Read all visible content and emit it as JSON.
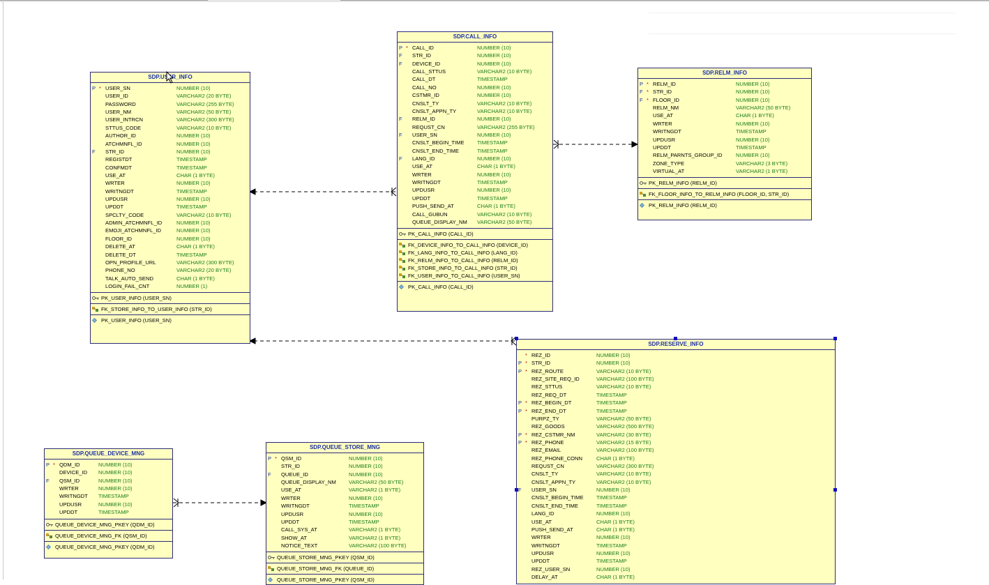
{
  "tables": {
    "user_info": {
      "title": "SDP.USER_INFO",
      "columns": [
        {
          "k": "P",
          "m": "*",
          "n": "USER_SN",
          "t": "NUMBER (10)"
        },
        {
          "k": "",
          "m": "",
          "n": "USER_ID",
          "t": "VARCHAR2 (20 BYTE)"
        },
        {
          "k": "",
          "m": "",
          "n": "PASSWORD",
          "t": "VARCHAR2 (255 BYTE)"
        },
        {
          "k": "",
          "m": "",
          "n": "USER_NM",
          "t": "VARCHAR2 (50 BYTE)"
        },
        {
          "k": "",
          "m": "",
          "n": "USER_INTRCN",
          "t": "VARCHAR2 (300 BYTE)"
        },
        {
          "k": "",
          "m": "",
          "n": "STTUS_CODE",
          "t": "VARCHAR2 (10 BYTE)"
        },
        {
          "k": "",
          "m": "",
          "n": "AUTHOR_ID",
          "t": "NUMBER (10)"
        },
        {
          "k": "",
          "m": "",
          "n": "ATCHMNFL_ID",
          "t": "NUMBER (10)"
        },
        {
          "k": "F",
          "m": "",
          "n": "STR_ID",
          "t": "NUMBER (10)"
        },
        {
          "k": "",
          "m": "",
          "n": "REGISTDT",
          "t": "TIMESTAMP"
        },
        {
          "k": "",
          "m": "",
          "n": "CONFMDT",
          "t": "TIMESTAMP"
        },
        {
          "k": "",
          "m": "",
          "n": "USE_AT",
          "t": "CHAR (1 BYTE)"
        },
        {
          "k": "",
          "m": "",
          "n": "WRTER",
          "t": "NUMBER (10)"
        },
        {
          "k": "",
          "m": "",
          "n": "WRITNGDT",
          "t": "TIMESTAMP"
        },
        {
          "k": "",
          "m": "",
          "n": "UPDUSR",
          "t": "NUMBER (10)"
        },
        {
          "k": "",
          "m": "",
          "n": "UPDDT",
          "t": "TIMESTAMP"
        },
        {
          "k": "",
          "m": "",
          "n": "SPCLTY_CODE",
          "t": "VARCHAR2 (10 BYTE)"
        },
        {
          "k": "",
          "m": "",
          "n": "ADMIN_ATCHMNFL_ID",
          "t": "NUMBER (10)"
        },
        {
          "k": "",
          "m": "",
          "n": "EMOJI_ATCHMNFL_ID",
          "t": "NUMBER (10)"
        },
        {
          "k": "",
          "m": "",
          "n": "FLOOR_ID",
          "t": "NUMBER (10)"
        },
        {
          "k": "",
          "m": "",
          "n": "DELETE_AT",
          "t": "CHAR (1 BYTE)"
        },
        {
          "k": "",
          "m": "",
          "n": "DELETE_DT",
          "t": "TIMESTAMP"
        },
        {
          "k": "",
          "m": "",
          "n": "OPN_PROFILE_URL",
          "t": "VARCHAR2 (300 BYTE)"
        },
        {
          "k": "",
          "m": "",
          "n": "PHONE_NO",
          "t": "VARCHAR2 (20 BYTE)"
        },
        {
          "k": "",
          "m": "",
          "n": "TALK_AUTO_SEND",
          "t": "CHAR (1 BYTE)"
        },
        {
          "k": "",
          "m": "",
          "n": "LOGIN_FAIL_CNT",
          "t": "NUMBER (1)"
        }
      ],
      "pk": [
        "PK_USER_INFO (USER_SN)"
      ],
      "fk": [
        "FK_STORE_INFO_TO_USER_INFO (STR_ID)"
      ],
      "idx": [
        "PK_USER_INFO (USER_SN)"
      ]
    },
    "call_info": {
      "title": "SDP.CALL_INFO",
      "columns": [
        {
          "k": "P",
          "m": "*",
          "n": "CALL_ID",
          "t": "NUMBER (10)"
        },
        {
          "k": "F",
          "m": "",
          "n": "STR_ID",
          "t": "NUMBER (10)"
        },
        {
          "k": "F",
          "m": "",
          "n": "DEVICE_ID",
          "t": "NUMBER (10)"
        },
        {
          "k": "",
          "m": "",
          "n": "CALL_STTUS",
          "t": "VARCHAR2 (10 BYTE)"
        },
        {
          "k": "",
          "m": "",
          "n": "CALL_DT",
          "t": "TIMESTAMP"
        },
        {
          "k": "",
          "m": "",
          "n": "CALL_NO",
          "t": "NUMBER (10)"
        },
        {
          "k": "",
          "m": "",
          "n": "CSTMR_ID",
          "t": "NUMBER (10)"
        },
        {
          "k": "",
          "m": "",
          "n": "CNSLT_TY",
          "t": "VARCHAR2 (10 BYTE)"
        },
        {
          "k": "",
          "m": "",
          "n": "CNSLT_APPN_TY",
          "t": "VARCHAR2 (10 BYTE)"
        },
        {
          "k": "F",
          "m": "",
          "n": "RELM_ID",
          "t": "NUMBER (10)"
        },
        {
          "k": "",
          "m": "",
          "n": "REQUST_CN",
          "t": "VARCHAR2 (255 BYTE)"
        },
        {
          "k": "F",
          "m": "",
          "n": "USER_SN",
          "t": "NUMBER (10)"
        },
        {
          "k": "",
          "m": "",
          "n": "CNSLT_BEGIN_TIME",
          "t": "TIMESTAMP"
        },
        {
          "k": "",
          "m": "",
          "n": "CNSLT_END_TIME",
          "t": "TIMESTAMP"
        },
        {
          "k": "F",
          "m": "",
          "n": "LANG_ID",
          "t": "NUMBER (10)"
        },
        {
          "k": "",
          "m": "",
          "n": "USE_AT",
          "t": "CHAR (1 BYTE)"
        },
        {
          "k": "",
          "m": "",
          "n": "WRTER",
          "t": "NUMBER (10)"
        },
        {
          "k": "",
          "m": "",
          "n": "WRITNGDT",
          "t": "TIMESTAMP"
        },
        {
          "k": "",
          "m": "",
          "n": "UPDUSR",
          "t": "NUMBER (10)"
        },
        {
          "k": "",
          "m": "",
          "n": "UPDDT",
          "t": "TIMESTAMP"
        },
        {
          "k": "",
          "m": "",
          "n": "PUSH_SEND_AT",
          "t": "CHAR (1 BYTE)"
        },
        {
          "k": "",
          "m": "",
          "n": "CALL_GUBUN",
          "t": "VARCHAR2 (10 BYTE)"
        },
        {
          "k": "",
          "m": "",
          "n": "QUEUE_DISPLAY_NM",
          "t": "VARCHAR2 (50 BYTE)"
        }
      ],
      "pk": [
        "PK_CALL_INFO (CALL_ID)"
      ],
      "fk": [
        "FK_DEVICE_INFO_TO_CALL_INFO (DEVICE_ID)",
        "FK_LANG_INFO_TO_CALL_INFO (LANG_ID)",
        "FK_RELM_INFO_TO_CALL_INFO (RELM_ID)",
        "FK_STORE_INFO_TO_CALL_INFO (STR_ID)",
        "FK_USER_INFO_TO_CALL_INFO (USER_SN)"
      ],
      "idx": [
        "PK_CALL_INFO (CALL_ID)"
      ]
    },
    "relm_info": {
      "title": "SDP.RELM_INFO",
      "columns": [
        {
          "k": "P",
          "m": "*",
          "n": "RELM_ID",
          "t": "NUMBER (10)"
        },
        {
          "k": "F",
          "m": "*",
          "n": "STR_ID",
          "t": "NUMBER (10)"
        },
        {
          "k": "F",
          "m": "*",
          "n": "FLOOR_ID",
          "t": "NUMBER (10)"
        },
        {
          "k": "",
          "m": "",
          "n": "RELM_NM",
          "t": "VARCHAR2 (50 BYTE)"
        },
        {
          "k": "",
          "m": "",
          "n": "USE_AT",
          "t": "CHAR (1 BYTE)"
        },
        {
          "k": "",
          "m": "",
          "n": "WRTER",
          "t": "NUMBER (10)"
        },
        {
          "k": "",
          "m": "",
          "n": "WRITNGDT",
          "t": "TIMESTAMP"
        },
        {
          "k": "",
          "m": "",
          "n": "UPDUSR",
          "t": "NUMBER (10)"
        },
        {
          "k": "",
          "m": "",
          "n": "UPDDT",
          "t": "TIMESTAMP"
        },
        {
          "k": "",
          "m": "",
          "n": "RELM_PARNTS_GROUP_ID",
          "t": "NUMBER (10)"
        },
        {
          "k": "",
          "m": "",
          "n": "ZONE_TYPE",
          "t": "VARCHAR2 (3 BYTE)"
        },
        {
          "k": "",
          "m": "",
          "n": "VIRTUAL_AT",
          "t": "VARCHAR2 (1 BYTE)"
        }
      ],
      "pk": [
        "PK_RELM_INFO (RELM_ID)"
      ],
      "fk": [
        "FK_FLOOR_INFO_TO_RELM_INFO (FLOOR_ID, STR_ID)"
      ],
      "idx": [
        "PK_RELM_INFO (RELM_ID)"
      ]
    },
    "reserve_info": {
      "title": "SDP.RESERVE_INFO",
      "columns": [
        {
          "k": "",
          "m": "*",
          "n": "REZ_ID",
          "t": "NUMBER (10)"
        },
        {
          "k": "P",
          "m": "*",
          "n": "STR_ID",
          "t": "NUMBER (10)"
        },
        {
          "k": "P",
          "m": "*",
          "n": "REZ_ROUTE",
          "t": "VARCHAR2 (10 BYTE)"
        },
        {
          "k": "",
          "m": "",
          "n": "REZ_SITE_REQ_ID",
          "t": "VARCHAR2 (100 BYTE)"
        },
        {
          "k": "",
          "m": "",
          "n": "REZ_STTUS",
          "t": "VARCHAR2 (10 BYTE)"
        },
        {
          "k": "",
          "m": "",
          "n": "REZ_REQ_DT",
          "t": "TIMESTAMP"
        },
        {
          "k": "P",
          "m": "*",
          "n": "REZ_BEGIN_DT",
          "t": "TIMESTAMP"
        },
        {
          "k": "P",
          "m": "*",
          "n": "REZ_END_DT",
          "t": "TIMESTAMP"
        },
        {
          "k": "",
          "m": "",
          "n": "PURPZ_TY",
          "t": "VARCHAR2 (50 BYTE)"
        },
        {
          "k": "",
          "m": "",
          "n": "REZ_GOODS",
          "t": "VARCHAR2 (500 BYTE)"
        },
        {
          "k": "P",
          "m": "*",
          "n": "REZ_CSTMR_NM",
          "t": "VARCHAR2 (30 BYTE)"
        },
        {
          "k": "P",
          "m": "*",
          "n": "REZ_PHONE",
          "t": "VARCHAR2 (15 BYTE)"
        },
        {
          "k": "",
          "m": "",
          "n": "REZ_EMAIL",
          "t": "VARCHAR2 (100 BYTE)"
        },
        {
          "k": "",
          "m": "",
          "n": "REZ_PHONE_CONN",
          "t": "CHAR (1 BYTE)"
        },
        {
          "k": "",
          "m": "",
          "n": "REQUST_CN",
          "t": "VARCHAR2 (300 BYTE)"
        },
        {
          "k": "",
          "m": "",
          "n": "CNSLT_TY",
          "t": "VARCHAR2 (10 BYTE)"
        },
        {
          "k": "",
          "m": "",
          "n": "CNSLT_APPN_TY",
          "t": "VARCHAR2 (10 BYTE)"
        },
        {
          "k": "F",
          "m": "",
          "n": "USER_SN",
          "t": "NUMBER (10)"
        },
        {
          "k": "",
          "m": "",
          "n": "CNSLT_BEGIN_TIME",
          "t": "TIMESTAMP"
        },
        {
          "k": "",
          "m": "",
          "n": "CNSLT_END_TIME",
          "t": "TIMESTAMP"
        },
        {
          "k": "",
          "m": "",
          "n": "LANG_ID",
          "t": "NUMBER (10)"
        },
        {
          "k": "",
          "m": "",
          "n": "USE_AT",
          "t": "CHAR (1 BYTE)"
        },
        {
          "k": "",
          "m": "",
          "n": "PUSH_SEND_AT",
          "t": "CHAR (1 BYTE)"
        },
        {
          "k": "",
          "m": "",
          "n": "WRTER",
          "t": "NUMBER (10)"
        },
        {
          "k": "",
          "m": "",
          "n": "WRITNGDT",
          "t": "TIMESTAMP"
        },
        {
          "k": "",
          "m": "",
          "n": "UPDUSR",
          "t": "NUMBER (10)"
        },
        {
          "k": "",
          "m": "",
          "n": "UPDDT",
          "t": "TIMESTAMP"
        },
        {
          "k": "",
          "m": "",
          "n": "REZ_USER_SN",
          "t": "NUMBER (10)"
        },
        {
          "k": "",
          "m": "",
          "n": "DELAY_AT",
          "t": "CHAR (1 BYTE)"
        }
      ],
      "pk": [],
      "fk": [],
      "idx": []
    },
    "queue_device_mng": {
      "title": "SDP.QUEUE_DEVICE_MNG",
      "columns": [
        {
          "k": "P",
          "m": "*",
          "n": "QDM_ID",
          "t": "NUMBER (10)"
        },
        {
          "k": "",
          "m": "",
          "n": "DEVICE_ID",
          "t": "NUMBER (10)"
        },
        {
          "k": "F",
          "m": "",
          "n": "QSM_ID",
          "t": "NUMBER (10)"
        },
        {
          "k": "",
          "m": "",
          "n": "WRTER",
          "t": "NUMBER (10)"
        },
        {
          "k": "",
          "m": "",
          "n": "WRITNGDT",
          "t": "TIMESTAMP"
        },
        {
          "k": "",
          "m": "",
          "n": "UPDUSR",
          "t": "NUMBER (10)"
        },
        {
          "k": "",
          "m": "",
          "n": "UPDDT",
          "t": "TIMESTAMP"
        }
      ],
      "pk": [
        "QUEUE_DEVICE_MNG_PKEY (QDM_ID)"
      ],
      "fk": [
        "QUEUE_DEVICE_MNG_FK (QSM_ID)"
      ],
      "idx": [
        "QUEUE_DEVICE_MNG_PKEY (QDM_ID)"
      ]
    },
    "queue_store_mng": {
      "title": "SDP.QUEUE_STORE_MNG",
      "columns": [
        {
          "k": "P",
          "m": "*",
          "n": "QSM_ID",
          "t": "NUMBER (10)"
        },
        {
          "k": "",
          "m": "",
          "n": "STR_ID",
          "t": "NUMBER (10)"
        },
        {
          "k": "F",
          "m": "",
          "n": "QUEUE_ID",
          "t": "NUMBER (10)"
        },
        {
          "k": "",
          "m": "",
          "n": "QUEUE_DISPLAY_NM",
          "t": "VARCHAR2 (50 BYTE)"
        },
        {
          "k": "",
          "m": "",
          "n": "USE_AT",
          "t": "VARCHAR2 (1 BYTE)"
        },
        {
          "k": "",
          "m": "",
          "n": "WRTER",
          "t": "NUMBER (10)"
        },
        {
          "k": "",
          "m": "",
          "n": "WRITNGDT",
          "t": "TIMESTAMP"
        },
        {
          "k": "",
          "m": "",
          "n": "UPDUSR",
          "t": "NUMBER (10)"
        },
        {
          "k": "",
          "m": "",
          "n": "UPDDT",
          "t": "TIMESTAMP"
        },
        {
          "k": "",
          "m": "",
          "n": "CALL_SYS_AT",
          "t": "VARCHAR2 (1 BYTE)"
        },
        {
          "k": "",
          "m": "",
          "n": "SHOW_AT",
          "t": "VARCHAR2 (1 BYTE)"
        },
        {
          "k": "",
          "m": "",
          "n": "NOTICE_TEXT",
          "t": "VARCHAR2 (100 BYTE)"
        }
      ],
      "pk": [
        "QUEUE_STORE_MNG_PKEY (QSM_ID)"
      ],
      "fk": [
        "QUEUE_STORE_MNG_FK (QUEUE_ID)"
      ],
      "idx": [
        "QUEUE_STORE_MNG_PKEY (QSM_ID)"
      ]
    }
  },
  "colors": {
    "entity_fill": "#ffffc0",
    "entity_border": "#2b2b7a",
    "title_text": "#1c2fa6",
    "type_text": "#1a7d1a",
    "mandatory": "#c00000",
    "selection_handle": "#1010c0"
  },
  "icons": {
    "pk": "key-icon",
    "fk": "foreign-key-icon",
    "index": "index-diamond-icon",
    "crowsfoot": "crows-foot-icon"
  }
}
